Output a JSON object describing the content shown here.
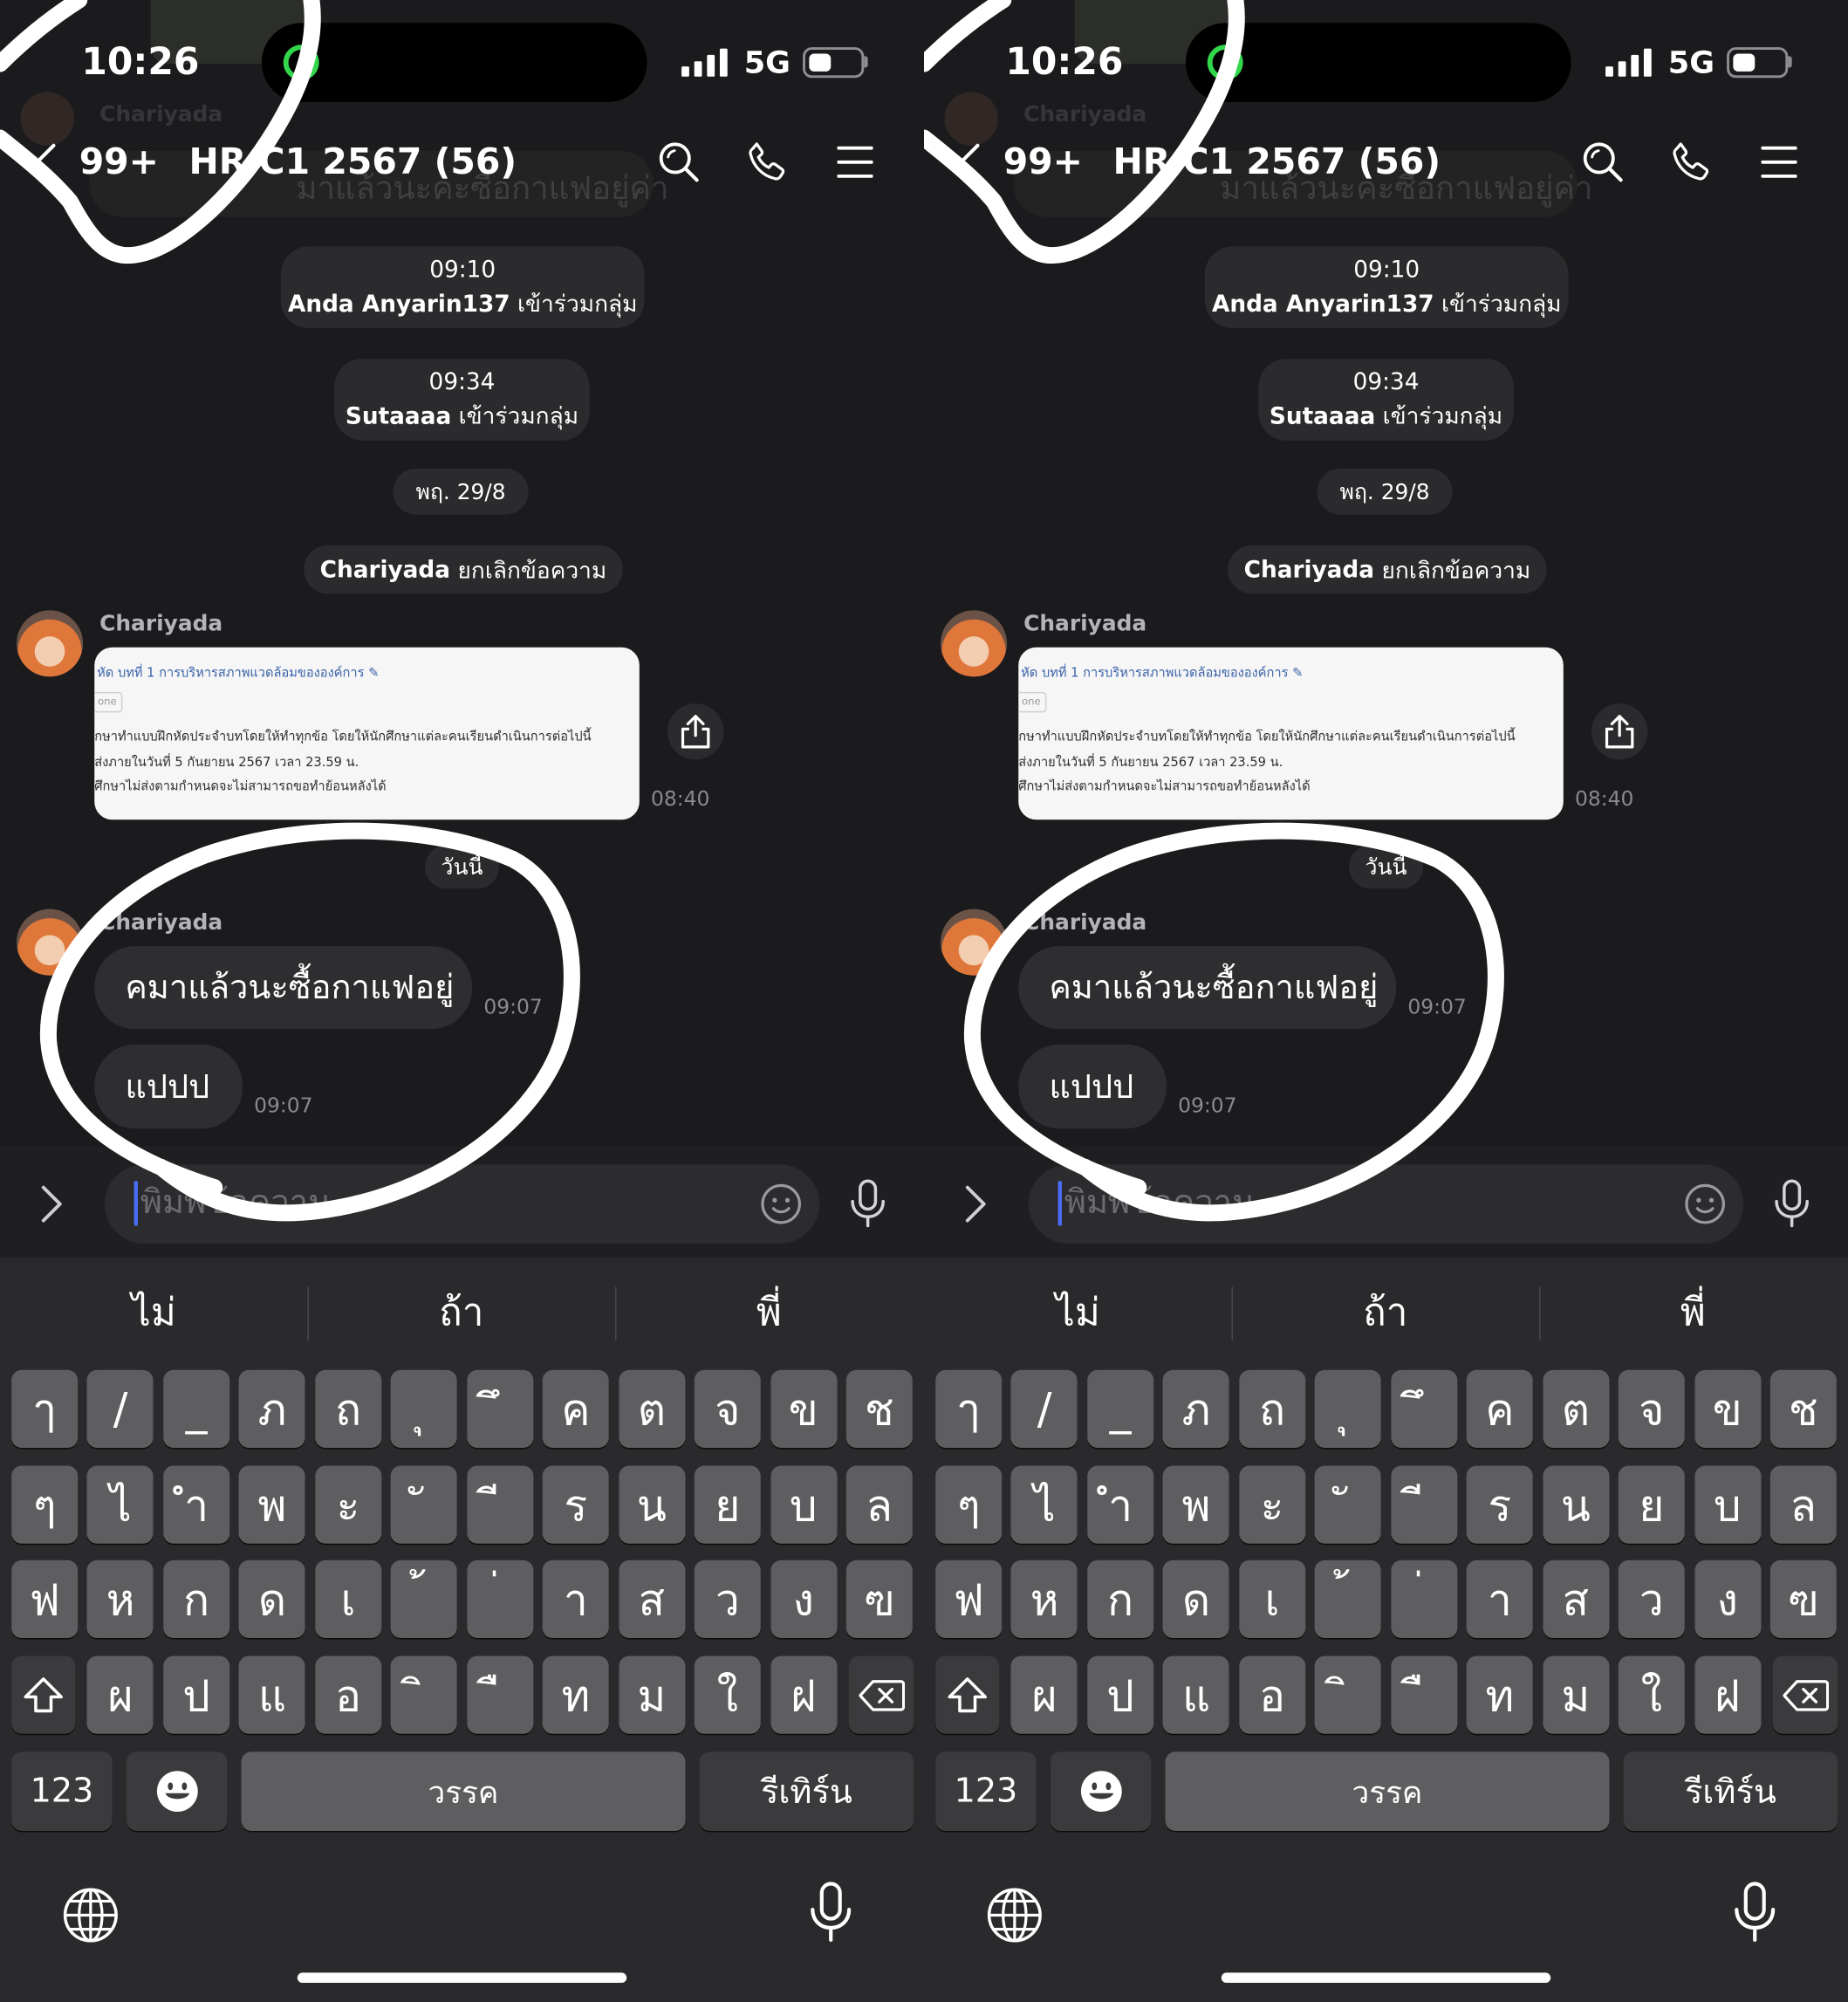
{
  "status_bar": {
    "time": "10:26",
    "network": "5G",
    "battery_level": 0.45
  },
  "header": {
    "unread_count": "99+",
    "title": "HR C1 2567 (56)"
  },
  "pinned_preview": {
    "sender": "Chariyada",
    "text": "มาแล้วนะคะซื้อกาแฟอยู่ค่า"
  },
  "system_messages": [
    {
      "time": "09:10",
      "actor": "Anda Anyarin137",
      "action": "เข้าร่วมกลุ่ม"
    },
    {
      "time": "09:34",
      "actor": "Sutaaaa",
      "action": "เข้าร่วมกลุ่ม"
    }
  ],
  "date_separators": [
    "พฤ. 29/8",
    "วันนี้"
  ],
  "unsend_notice": {
    "actor": "Chariyada",
    "action": "ยกเลิกข้อความ"
  },
  "image_message": {
    "sender": "Chariyada",
    "time": "08:40",
    "preview": {
      "title": "หัด บทที่ 1 การบริหารสภาพแวดล้อมขององค์การ",
      "badge": "one",
      "lines": [
        "กษาทำแบบฝึกหัดประจำบทโดยให้ทำทุกข้อ โดยให้นักศึกษาแต่ละคนเรียนดำเนินการต่อไปนี้",
        "ส่งภายในวันที่ 5 กันยายน 2567 เวลา 23.59 น.",
        "ศึกษาไม่ส่งตามกำหนดจะไม่สามารถขอทำย้อนหลังได้"
      ]
    }
  },
  "messages": [
    {
      "sender": "Chariyada",
      "text": "คมาแล้วนะซื้อกาแฟอยู่",
      "time": "09:07"
    },
    {
      "text": "แปปป",
      "time": "09:07"
    }
  ],
  "composer": {
    "placeholder": "พิมพ์ข้อความ"
  },
  "keyboard": {
    "suggestions": [
      "ไม่",
      "ถ้า",
      "พี่"
    ],
    "rows": [
      [
        "ๅ",
        "/",
        "_",
        "ภ",
        "ถ",
        "ุ",
        "ึ",
        "ค",
        "ต",
        "จ",
        "ข",
        "ช"
      ],
      [
        "ๆ",
        "ไ",
        "ำ",
        "พ",
        "ะ",
        "ั",
        "ี",
        "ร",
        "น",
        "ย",
        "บ",
        "ล"
      ],
      [
        "ฟ",
        "ห",
        "ก",
        "ด",
        "เ",
        "้",
        "่",
        "า",
        "ส",
        "ว",
        "ง",
        "ฃ"
      ],
      [
        "ผ",
        "ป",
        "แ",
        "อ",
        "ิ",
        "ื",
        "ท",
        "ม",
        "ใ",
        "ฝ"
      ]
    ],
    "numbers_key": "123",
    "space_key": "วรรค",
    "return_key": "รีเทิร์น"
  },
  "icons": {
    "back": "chevron-left-icon",
    "search": "search-icon",
    "call": "phone-icon",
    "menu": "menu-icon",
    "share": "share-icon",
    "expand": "chevron-right-icon",
    "emoji": "smiley-icon",
    "voice": "microphone-icon",
    "globe": "globe-icon",
    "shift": "shift-icon",
    "delete": "backspace-icon"
  },
  "colors": {
    "chat_background": "#1b1b1d",
    "bubble": "#2e2e30",
    "caret": "#4a6cf7",
    "camera_indicator": "#32d74b",
    "key": "#5e5e60",
    "key_special": "#3b3b3d",
    "annotation": "#ffffff"
  }
}
